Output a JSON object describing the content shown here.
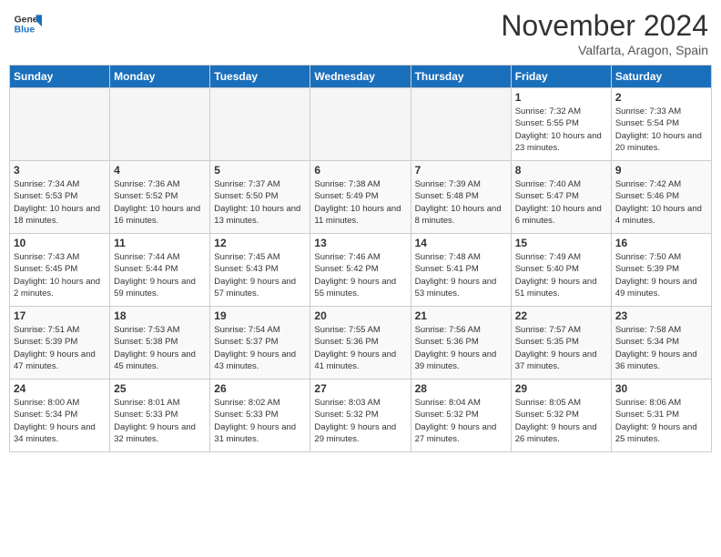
{
  "header": {
    "logo_general": "General",
    "logo_blue": "Blue",
    "month_title": "November 2024",
    "location": "Valfarta, Aragon, Spain"
  },
  "days_of_week": [
    "Sunday",
    "Monday",
    "Tuesday",
    "Wednesday",
    "Thursday",
    "Friday",
    "Saturday"
  ],
  "weeks": [
    [
      {
        "day": "",
        "empty": true
      },
      {
        "day": "",
        "empty": true
      },
      {
        "day": "",
        "empty": true
      },
      {
        "day": "",
        "empty": true
      },
      {
        "day": "",
        "empty": true
      },
      {
        "day": "1",
        "sunrise": "7:32 AM",
        "sunset": "5:55 PM",
        "daylight": "10 hours and 23 minutes."
      },
      {
        "day": "2",
        "sunrise": "7:33 AM",
        "sunset": "5:54 PM",
        "daylight": "10 hours and 20 minutes."
      }
    ],
    [
      {
        "day": "3",
        "sunrise": "7:34 AM",
        "sunset": "5:53 PM",
        "daylight": "10 hours and 18 minutes."
      },
      {
        "day": "4",
        "sunrise": "7:36 AM",
        "sunset": "5:52 PM",
        "daylight": "10 hours and 16 minutes."
      },
      {
        "day": "5",
        "sunrise": "7:37 AM",
        "sunset": "5:50 PM",
        "daylight": "10 hours and 13 minutes."
      },
      {
        "day": "6",
        "sunrise": "7:38 AM",
        "sunset": "5:49 PM",
        "daylight": "10 hours and 11 minutes."
      },
      {
        "day": "7",
        "sunrise": "7:39 AM",
        "sunset": "5:48 PM",
        "daylight": "10 hours and 8 minutes."
      },
      {
        "day": "8",
        "sunrise": "7:40 AM",
        "sunset": "5:47 PM",
        "daylight": "10 hours and 6 minutes."
      },
      {
        "day": "9",
        "sunrise": "7:42 AM",
        "sunset": "5:46 PM",
        "daylight": "10 hours and 4 minutes."
      }
    ],
    [
      {
        "day": "10",
        "sunrise": "7:43 AM",
        "sunset": "5:45 PM",
        "daylight": "10 hours and 2 minutes."
      },
      {
        "day": "11",
        "sunrise": "7:44 AM",
        "sunset": "5:44 PM",
        "daylight": "9 hours and 59 minutes."
      },
      {
        "day": "12",
        "sunrise": "7:45 AM",
        "sunset": "5:43 PM",
        "daylight": "9 hours and 57 minutes."
      },
      {
        "day": "13",
        "sunrise": "7:46 AM",
        "sunset": "5:42 PM",
        "daylight": "9 hours and 55 minutes."
      },
      {
        "day": "14",
        "sunrise": "7:48 AM",
        "sunset": "5:41 PM",
        "daylight": "9 hours and 53 minutes."
      },
      {
        "day": "15",
        "sunrise": "7:49 AM",
        "sunset": "5:40 PM",
        "daylight": "9 hours and 51 minutes."
      },
      {
        "day": "16",
        "sunrise": "7:50 AM",
        "sunset": "5:39 PM",
        "daylight": "9 hours and 49 minutes."
      }
    ],
    [
      {
        "day": "17",
        "sunrise": "7:51 AM",
        "sunset": "5:39 PM",
        "daylight": "9 hours and 47 minutes."
      },
      {
        "day": "18",
        "sunrise": "7:53 AM",
        "sunset": "5:38 PM",
        "daylight": "9 hours and 45 minutes."
      },
      {
        "day": "19",
        "sunrise": "7:54 AM",
        "sunset": "5:37 PM",
        "daylight": "9 hours and 43 minutes."
      },
      {
        "day": "20",
        "sunrise": "7:55 AM",
        "sunset": "5:36 PM",
        "daylight": "9 hours and 41 minutes."
      },
      {
        "day": "21",
        "sunrise": "7:56 AM",
        "sunset": "5:36 PM",
        "daylight": "9 hours and 39 minutes."
      },
      {
        "day": "22",
        "sunrise": "7:57 AM",
        "sunset": "5:35 PM",
        "daylight": "9 hours and 37 minutes."
      },
      {
        "day": "23",
        "sunrise": "7:58 AM",
        "sunset": "5:34 PM",
        "daylight": "9 hours and 36 minutes."
      }
    ],
    [
      {
        "day": "24",
        "sunrise": "8:00 AM",
        "sunset": "5:34 PM",
        "daylight": "9 hours and 34 minutes."
      },
      {
        "day": "25",
        "sunrise": "8:01 AM",
        "sunset": "5:33 PM",
        "daylight": "9 hours and 32 minutes."
      },
      {
        "day": "26",
        "sunrise": "8:02 AM",
        "sunset": "5:33 PM",
        "daylight": "9 hours and 31 minutes."
      },
      {
        "day": "27",
        "sunrise": "8:03 AM",
        "sunset": "5:32 PM",
        "daylight": "9 hours and 29 minutes."
      },
      {
        "day": "28",
        "sunrise": "8:04 AM",
        "sunset": "5:32 PM",
        "daylight": "9 hours and 27 minutes."
      },
      {
        "day": "29",
        "sunrise": "8:05 AM",
        "sunset": "5:32 PM",
        "daylight": "9 hours and 26 minutes."
      },
      {
        "day": "30",
        "sunrise": "8:06 AM",
        "sunset": "5:31 PM",
        "daylight": "9 hours and 25 minutes."
      }
    ]
  ],
  "labels": {
    "sunrise": "Sunrise:",
    "sunset": "Sunset:",
    "daylight": "Daylight:"
  }
}
